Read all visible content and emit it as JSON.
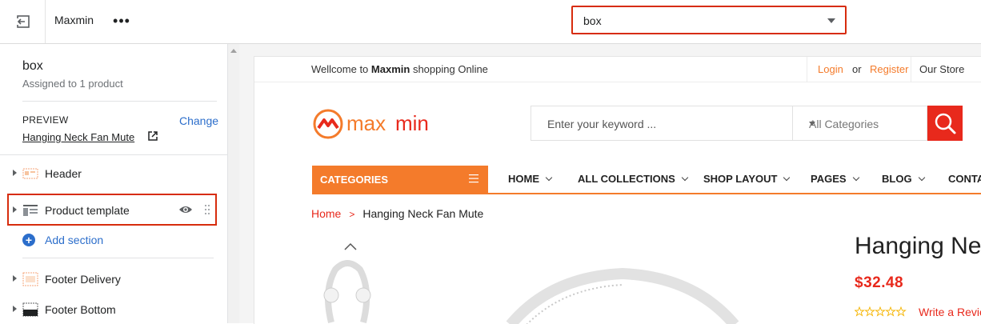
{
  "topbar": {
    "store_name": "Maxmin",
    "more_label": "•••",
    "template_select_value": "box"
  },
  "sidebar": {
    "title": "box",
    "subtitle": "Assigned to 1 product",
    "preview_label": "PREVIEW",
    "change_label": "Change",
    "preview_product": "Hanging Neck Fan Mute",
    "sections": [
      {
        "label": "Header",
        "icon": "header-section-icon"
      },
      {
        "label": "Product template",
        "icon": "template-section-icon"
      },
      {
        "label": "Footer Delivery",
        "icon": "footer-delivery-icon"
      },
      {
        "label": "Footer Bottom",
        "icon": "footer-bottom-icon"
      }
    ],
    "add_section_label": "Add section"
  },
  "shop": {
    "welcome_pre": "Wellcome to",
    "welcome_brand": "Maxmin",
    "welcome_post": "shopping Online",
    "login": "Login",
    "or": "or",
    "register": "Register",
    "our_store": "Our Store",
    "logo_text_a": "max",
    "logo_text_b": "min",
    "search_placeholder": "Enter your keyword ...",
    "category_select": "All Categories",
    "categories_button": "CATEGORIES",
    "nav": [
      "HOME",
      "ALL COLLECTIONS",
      "SHOP LAYOUT",
      "PAGES",
      "BLOG",
      "CONTAC"
    ],
    "breadcrumb_home": "Home",
    "breadcrumb_sep": ">",
    "breadcrumb_current": "Hanging Neck Fan Mute",
    "product_title": "Hanging Nec",
    "product_price": "$32.48",
    "write_review": "Write a Review",
    "rating_stars": 0,
    "accent_color": "#f47b2b",
    "price_color": "#e8291c",
    "highlight_color": "#d72c0d"
  }
}
